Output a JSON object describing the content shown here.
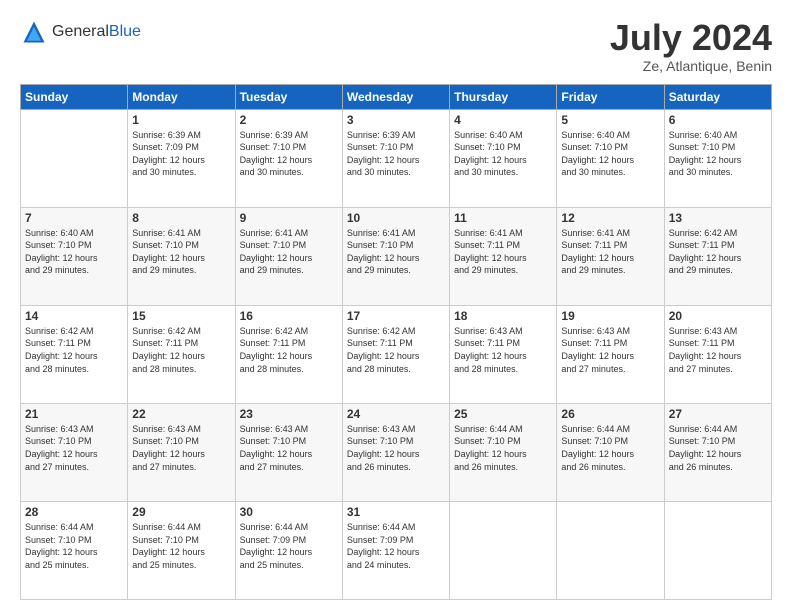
{
  "logo": {
    "general": "General",
    "blue": "Blue"
  },
  "header": {
    "month_year": "July 2024",
    "location": "Ze, Atlantique, Benin"
  },
  "weekdays": [
    "Sunday",
    "Monday",
    "Tuesday",
    "Wednesday",
    "Thursday",
    "Friday",
    "Saturday"
  ],
  "weeks": [
    [
      {
        "day": "",
        "info": ""
      },
      {
        "day": "1",
        "info": "Sunrise: 6:39 AM\nSunset: 7:09 PM\nDaylight: 12 hours\nand 30 minutes."
      },
      {
        "day": "2",
        "info": "Sunrise: 6:39 AM\nSunset: 7:10 PM\nDaylight: 12 hours\nand 30 minutes."
      },
      {
        "day": "3",
        "info": "Sunrise: 6:39 AM\nSunset: 7:10 PM\nDaylight: 12 hours\nand 30 minutes."
      },
      {
        "day": "4",
        "info": "Sunrise: 6:40 AM\nSunset: 7:10 PM\nDaylight: 12 hours\nand 30 minutes."
      },
      {
        "day": "5",
        "info": "Sunrise: 6:40 AM\nSunset: 7:10 PM\nDaylight: 12 hours\nand 30 minutes."
      },
      {
        "day": "6",
        "info": "Sunrise: 6:40 AM\nSunset: 7:10 PM\nDaylight: 12 hours\nand 30 minutes."
      }
    ],
    [
      {
        "day": "7",
        "info": ""
      },
      {
        "day": "8",
        "info": "Sunrise: 6:41 AM\nSunset: 7:10 PM\nDaylight: 12 hours\nand 29 minutes."
      },
      {
        "day": "9",
        "info": "Sunrise: 6:41 AM\nSunset: 7:10 PM\nDaylight: 12 hours\nand 29 minutes."
      },
      {
        "day": "10",
        "info": "Sunrise: 6:41 AM\nSunset: 7:10 PM\nDaylight: 12 hours\nand 29 minutes."
      },
      {
        "day": "11",
        "info": "Sunrise: 6:41 AM\nSunset: 7:11 PM\nDaylight: 12 hours\nand 29 minutes."
      },
      {
        "day": "12",
        "info": "Sunrise: 6:41 AM\nSunset: 7:11 PM\nDaylight: 12 hours\nand 29 minutes."
      },
      {
        "day": "13",
        "info": "Sunrise: 6:42 AM\nSunset: 7:11 PM\nDaylight: 12 hours\nand 29 minutes."
      }
    ],
    [
      {
        "day": "14",
        "info": ""
      },
      {
        "day": "15",
        "info": "Sunrise: 6:42 AM\nSunset: 7:11 PM\nDaylight: 12 hours\nand 28 minutes."
      },
      {
        "day": "16",
        "info": "Sunrise: 6:42 AM\nSunset: 7:11 PM\nDaylight: 12 hours\nand 28 minutes."
      },
      {
        "day": "17",
        "info": "Sunrise: 6:42 AM\nSunset: 7:11 PM\nDaylight: 12 hours\nand 28 minutes."
      },
      {
        "day": "18",
        "info": "Sunrise: 6:43 AM\nSunset: 7:11 PM\nDaylight: 12 hours\nand 28 minutes."
      },
      {
        "day": "19",
        "info": "Sunrise: 6:43 AM\nSunset: 7:11 PM\nDaylight: 12 hours\nand 27 minutes."
      },
      {
        "day": "20",
        "info": "Sunrise: 6:43 AM\nSunset: 7:11 PM\nDaylight: 12 hours\nand 27 minutes."
      }
    ],
    [
      {
        "day": "21",
        "info": ""
      },
      {
        "day": "22",
        "info": "Sunrise: 6:43 AM\nSunset: 7:10 PM\nDaylight: 12 hours\nand 27 minutes."
      },
      {
        "day": "23",
        "info": "Sunrise: 6:43 AM\nSunset: 7:10 PM\nDaylight: 12 hours\nand 27 minutes."
      },
      {
        "day": "24",
        "info": "Sunrise: 6:43 AM\nSunset: 7:10 PM\nDaylight: 12 hours\nand 26 minutes."
      },
      {
        "day": "25",
        "info": "Sunrise: 6:44 AM\nSunset: 7:10 PM\nDaylight: 12 hours\nand 26 minutes."
      },
      {
        "day": "26",
        "info": "Sunrise: 6:44 AM\nSunset: 7:10 PM\nDaylight: 12 hours\nand 26 minutes."
      },
      {
        "day": "27",
        "info": "Sunrise: 6:44 AM\nSunset: 7:10 PM\nDaylight: 12 hours\nand 26 minutes."
      }
    ],
    [
      {
        "day": "28",
        "info": "Sunrise: 6:44 AM\nSunset: 7:10 PM\nDaylight: 12 hours\nand 25 minutes."
      },
      {
        "day": "29",
        "info": "Sunrise: 6:44 AM\nSunset: 7:10 PM\nDaylight: 12 hours\nand 25 minutes."
      },
      {
        "day": "30",
        "info": "Sunrise: 6:44 AM\nSunset: 7:09 PM\nDaylight: 12 hours\nand 25 minutes."
      },
      {
        "day": "31",
        "info": "Sunrise: 6:44 AM\nSunset: 7:09 PM\nDaylight: 12 hours\nand 24 minutes."
      },
      {
        "day": "",
        "info": ""
      },
      {
        "day": "",
        "info": ""
      },
      {
        "day": "",
        "info": ""
      }
    ]
  ],
  "week7_sunday": "Sunrise: 6:40 AM\nSunset: 7:10 PM\nDaylight: 12 hours\nand 29 minutes.",
  "week14_sunday": "Sunrise: 6:42 AM\nSunset: 7:11 PM\nDaylight: 12 hours\nand 28 minutes.",
  "week21_sunday": "Sunrise: 6:43 AM\nSunset: 7:10 PM\nDaylight: 12 hours\nand 27 minutes."
}
